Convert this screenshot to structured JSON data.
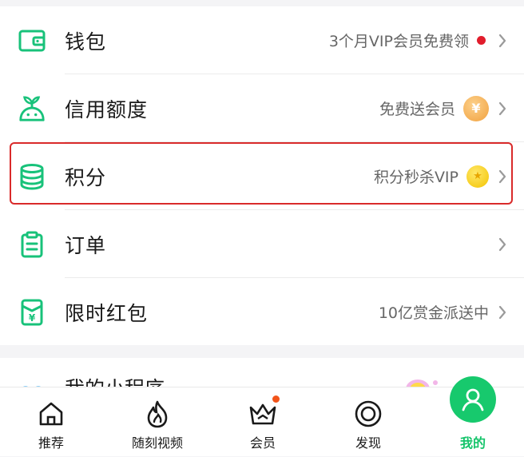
{
  "menu": {
    "items": [
      {
        "label": "钱包",
        "hint": "3个月VIP会员免费领",
        "icon": "wallet-icon"
      },
      {
        "label": "信用额度",
        "hint": "免费送会员",
        "icon": "sprout-icon",
        "badge": "¥"
      },
      {
        "label": "积分",
        "hint": "积分秒杀VIP",
        "icon": "coins-stack-icon"
      },
      {
        "label": "订单",
        "hint": "",
        "icon": "clipboard-icon"
      },
      {
        "label": "限时红包",
        "hint": "10亿赏金派送中",
        "icon": "red-envelope-icon"
      }
    ],
    "highlighted_item": "积分"
  },
  "next_section": {
    "label": "我的小程序"
  },
  "tabbar": {
    "tabs": [
      {
        "label": "推荐",
        "icon": "home-icon"
      },
      {
        "label": "随刻视频",
        "icon": "flame-icon"
      },
      {
        "label": "会员",
        "icon": "crown-icon"
      },
      {
        "label": "发现",
        "icon": "discover-icon"
      },
      {
        "label": "我的",
        "icon": "profile-icon"
      }
    ],
    "active": "我的"
  },
  "colors": {
    "accent_green": "#17c96d",
    "icon_green": "#18c27a",
    "highlight_red": "#d92a2a",
    "notification_red": "#e11d2c",
    "notification_orange": "#f2541a"
  }
}
